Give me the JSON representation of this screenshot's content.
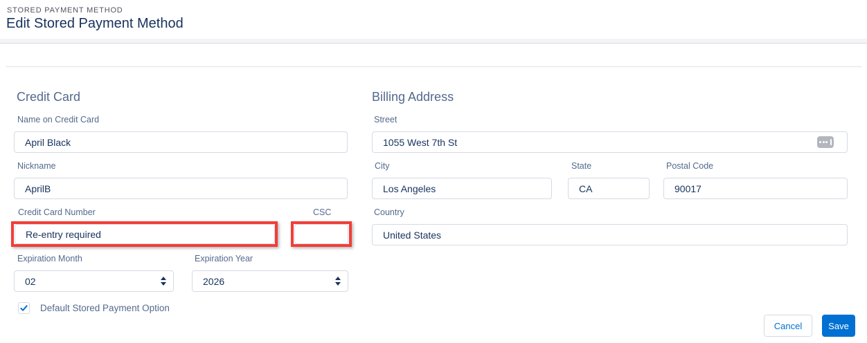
{
  "header": {
    "eyebrow": "STORED PAYMENT METHOD",
    "title": "Edit Stored Payment Method"
  },
  "credit_card": {
    "heading": "Credit Card",
    "name_label": "Name on Credit Card",
    "name_value": "April Black",
    "nickname_label": "Nickname",
    "nickname_value": "AprilB",
    "number_label": "Credit Card Number",
    "number_value": "Re-entry required",
    "csc_label": "CSC",
    "csc_value": "",
    "exp_month_label": "Expiration Month",
    "exp_month_value": "02",
    "exp_year_label": "Expiration Year",
    "exp_year_value": "2026",
    "default_option_label": "Default Stored Payment Option",
    "default_option_checked": true
  },
  "billing_address": {
    "heading": "Billing Address",
    "street_label": "Street",
    "street_value": "1055 West 7th St",
    "city_label": "City",
    "city_value": "Los Angeles",
    "state_label": "State",
    "state_value": "CA",
    "postal_label": "Postal Code",
    "postal_value": "90017",
    "country_label": "Country",
    "country_value": "United States"
  },
  "actions": {
    "cancel_label": "Cancel",
    "save_label": "Save"
  },
  "colors": {
    "accent_blue": "#0070d2",
    "annotation_red": "#f23d38",
    "label_slate": "#54698d",
    "value_navy": "#16325c"
  },
  "icons": {
    "street_expand": "ellipsis-expand-icon",
    "checkbox_check": "checkmark-icon",
    "month_spinner": "up-down-spinner-icon",
    "year_spinner": "up-down-spinner-icon"
  }
}
